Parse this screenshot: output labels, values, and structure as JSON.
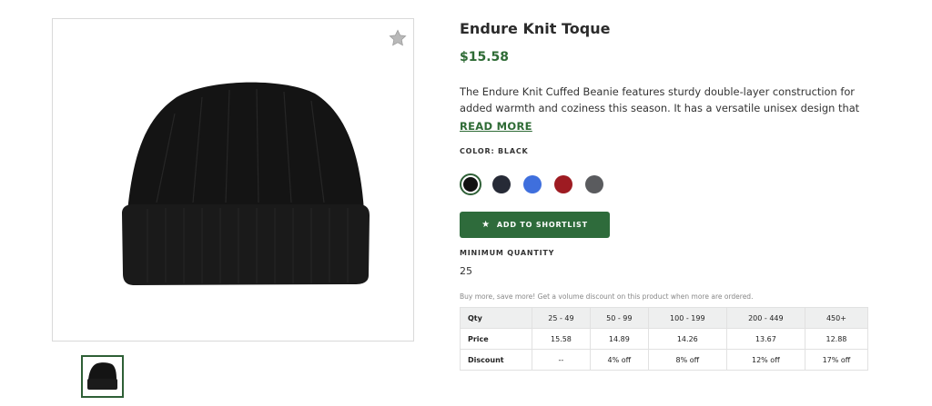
{
  "product": {
    "title": "Endure Knit Toque",
    "price": "$15.58",
    "description": "The Endure Knit Cuffed Beanie features sturdy double-layer construction for added warmth and coziness this season. It has a versatile unisex design that can be turned…",
    "read_more_label": "READ MORE",
    "color_label": "COLOR: BLACK",
    "colors": [
      {
        "name": "black",
        "hex": "#111111",
        "selected": true
      },
      {
        "name": "navy",
        "hex": "#262a36",
        "selected": false
      },
      {
        "name": "royal-blue",
        "hex": "#3f6fdd",
        "selected": false
      },
      {
        "name": "red",
        "hex": "#9e1b22",
        "selected": false
      },
      {
        "name": "grey",
        "hex": "#5a5b5e",
        "selected": false
      }
    ],
    "shortlist_button_label": "ADD TO SHORTLIST",
    "minimum_quantity_label": "MINIMUM QUANTITY",
    "minimum_quantity_value": "25",
    "volume_note": "Buy more, save more! Get a volume discount on this product when more are ordered.",
    "icons": {
      "favorite": "star-icon",
      "button": "star-icon"
    },
    "accent_color": "#2e6b35"
  },
  "pricing_table": {
    "headers": [
      "Qty",
      "25 - 49",
      "50 - 99",
      "100 - 199",
      "200 - 449",
      "450+"
    ],
    "rows": [
      {
        "label": "Price",
        "values": [
          "15.58",
          "14.89",
          "14.26",
          "13.67",
          "12.88"
        ]
      },
      {
        "label": "Discount",
        "values": [
          "--",
          "4% off",
          "8% off",
          "12% off",
          "17% off"
        ]
      }
    ]
  }
}
